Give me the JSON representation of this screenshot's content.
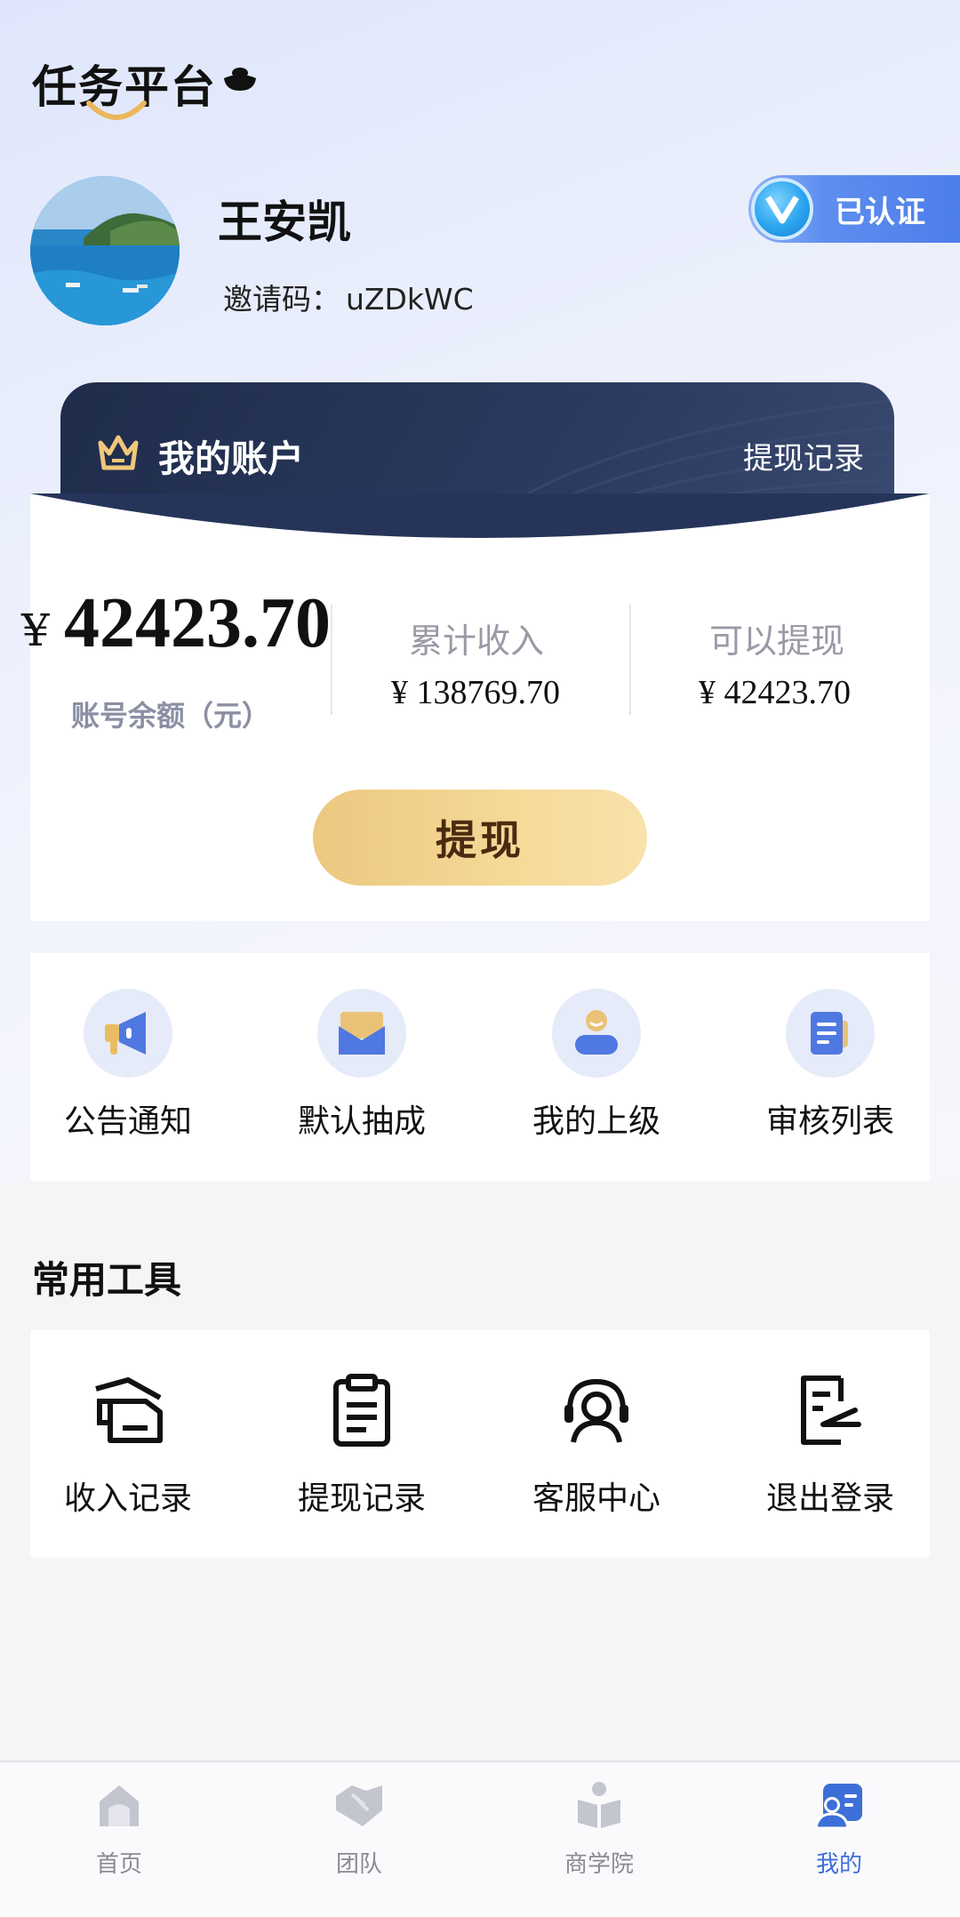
{
  "app": {
    "logo_text": "任务平台"
  },
  "profile": {
    "name": "王安凯",
    "invite_label": "邀请码：",
    "invite_code": "uZDkWC",
    "verified_label": "已认证"
  },
  "account": {
    "title": "我的账户",
    "record_link": "提现记录",
    "currency_symbol": "¥",
    "balance": "42423.70",
    "balance_label": "账号余额（元）",
    "total_income_label": "累计收入",
    "total_income_value": "¥ 138769.70",
    "withdrawable_label": "可以提现",
    "withdrawable_value": "¥ 42423.70",
    "withdraw_button": "提现"
  },
  "features": [
    {
      "label": "公告通知",
      "icon": "megaphone-icon"
    },
    {
      "label": "默认抽成",
      "icon": "envelope-icon"
    },
    {
      "label": "我的上级",
      "icon": "superior-user-icon"
    },
    {
      "label": "审核列表",
      "icon": "document-list-icon"
    }
  ],
  "tools": {
    "title": "常用工具",
    "items": [
      {
        "label": "收入记录",
        "icon": "income-record-icon"
      },
      {
        "label": "提现记录",
        "icon": "clipboard-icon"
      },
      {
        "label": "客服中心",
        "icon": "headset-icon"
      },
      {
        "label": "退出登录",
        "icon": "logout-doc-icon"
      }
    ]
  },
  "nav": [
    {
      "label": "首页",
      "icon": "home-icon"
    },
    {
      "label": "团队",
      "icon": "handshake-icon"
    },
    {
      "label": "商学院",
      "icon": "book-reader-icon"
    },
    {
      "label": "我的",
      "icon": "profile-card-icon",
      "active": true
    }
  ],
  "colors": {
    "accent": "#3d6fd8",
    "gold": "#ecc880",
    "navy": "#1f2c4b"
  }
}
